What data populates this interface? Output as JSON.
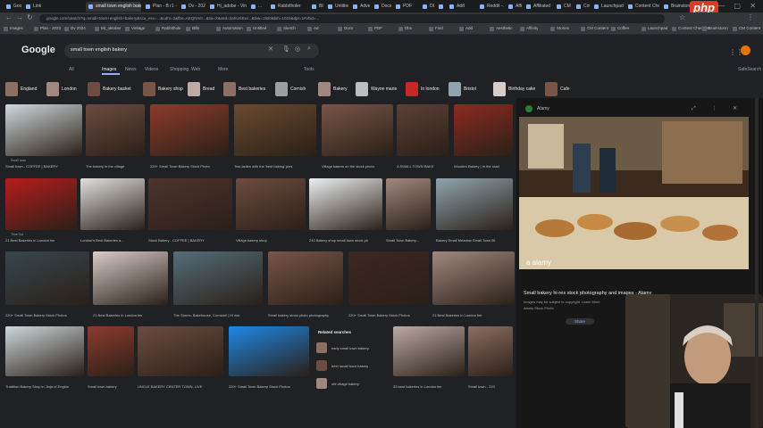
{
  "browser": {
    "tabs": [
      {
        "label": "Google"
      },
      {
        "label": "Link"
      },
      {
        "label": "small town english bakery"
      },
      {
        "label": "Plan - B r1 - 2023"
      },
      {
        "label": "Dv - 2024 - 2024"
      },
      {
        "label": "Hi_adobe - Vintage"
      },
      {
        "label": "..."
      },
      {
        "label": "Rabbitholer"
      },
      {
        "label": "Bills - Automation"
      },
      {
        "label": "Untitled - Sketch"
      },
      {
        "label": "Advertising"
      },
      {
        "label": "Docs"
      },
      {
        "label": "PDF"
      },
      {
        "label": "Dbx - ArI"
      },
      {
        "label": "Find"
      },
      {
        "label": "Add"
      },
      {
        "label": "Reddit - Aesthetic"
      },
      {
        "label": "Affinity"
      },
      {
        "label": "Affiliated - Stories"
      },
      {
        "label": "CM Content"
      },
      {
        "label": "Coffee"
      },
      {
        "label": "Launchpad"
      },
      {
        "label": "Content Checklist"
      },
      {
        "label": "Brainstorm"
      }
    ],
    "url": "google.com/search?q=small+town+english+bakery&sca_esv=...&udm=2&fbs=AEQNm0...&sa=X&ved=2ahUKEwi...&biw=1920&bih=1020&dpr=1#vhid=...",
    "watermark": "php",
    "bookmarks": [
      "Images",
      "Plan - 2023",
      "Dv 2024",
      "Mt_oktober",
      "Vintage",
      "Rabbithole",
      "Bills",
      "Automation",
      "Untitled",
      "Sketch",
      "Ad",
      "Docs",
      "PDF",
      "Dbx",
      "Find",
      "Add",
      "Aesthetic",
      "Affinity",
      "Stories",
      "CM Content",
      "Coffee",
      "Launchpad",
      "Content Checklist",
      "Brainstorm",
      "CM Content"
    ]
  },
  "google": {
    "logo": "Google",
    "query": "small town english bakery",
    "nav": [
      "All",
      "Images",
      "News",
      "Videos",
      "Shopping",
      "Web",
      "More"
    ],
    "tools": "Tools",
    "safesearch": "SafeSearch"
  },
  "chips": [
    {
      "label": "England",
      "color": "#8d6e63"
    },
    {
      "label": "London",
      "color": "#a1887f"
    },
    {
      "label": "Bakery basket",
      "color": "#6d4c41"
    },
    {
      "label": "Bakery shop",
      "color": "#795548"
    },
    {
      "label": "Bread",
      "color": "#bcaaa4"
    },
    {
      "label": "Best bakeries",
      "color": "#8d6e63"
    },
    {
      "label": "Cornish",
      "color": "#9e9e9e"
    },
    {
      "label": "Bakery",
      "color": "#a1887f"
    },
    {
      "label": "Wayne marie",
      "color": "#bdbdbd"
    },
    {
      "label": "In london",
      "color": "#c62828"
    },
    {
      "label": "Bristol",
      "color": "#90a4ae"
    },
    {
      "label": "Birthday cake",
      "color": "#d7ccc8"
    },
    {
      "label": "Cafe",
      "color": "#795548"
    }
  ],
  "results": [
    {
      "caption": "Small town - COFFEE | BAKERY",
      "source": "Small town",
      "color": "#cfd8dc"
    },
    {
      "caption": "The bakery in the village",
      "source": "",
      "color": "#6d4c41"
    },
    {
      "caption": "220+ Small Town Bakery Stock Photo",
      "source": "",
      "color": "#8d3b2b"
    },
    {
      "caption": "Two ladies with the 'best baking' pies",
      "source": "",
      "color": "#6b4a2f"
    },
    {
      "caption": "Village bakers on the stock photo",
      "source": "",
      "color": "#795548"
    },
    {
      "caption": "A SMALL TOWN BAKE",
      "source": "",
      "color": "#5d4037"
    },
    {
      "caption": "Wooden Bakery | In the road",
      "source": "",
      "color": "#8e2a20"
    },
    {
      "caption": "21 Best Bakeries in London tier",
      "source": "Time Out",
      "color": "#b71c1c"
    },
    {
      "caption": "London's Best Bakeries a...",
      "source": "",
      "color": "#e0e0e0"
    },
    {
      "caption": "Stock Bakery - COFFEE | BAKERY",
      "source": "",
      "color": "#4e342e"
    },
    {
      "caption": "Village bakery shop",
      "source": "",
      "color": "#6d4c41"
    },
    {
      "caption": "240 Bakery shop small town stock ph",
      "source": "",
      "color": "#eceff1"
    },
    {
      "caption": "Small Town Bakery...",
      "source": "",
      "color": "#a1887f"
    },
    {
      "caption": "Bakery Small Meadow Small Town Bt",
      "source": "",
      "color": "#90a4ae"
    },
    {
      "caption": "220+ Small Town Bakery Stock Photos",
      "source": "",
      "color": "#37474f"
    },
    {
      "caption": "21 Best Bakeries in London tier",
      "source": "",
      "color": "#d7ccc8"
    },
    {
      "caption": "The Stores, Bakehouse, Cornwall | HI rise",
      "source": "",
      "color": "#546e7a"
    },
    {
      "caption": "Small bakery stock photo photography",
      "source": "",
      "color": "#795548"
    },
    {
      "caption": "220+ Small Town Bakery Stock Photos",
      "source": "",
      "color": "#3e2723"
    },
    {
      "caption": "21 Best Bakeries in London tier",
      "source": "",
      "color": "#a1887f"
    },
    {
      "caption": "Tradition Bakery Shop in Jinja of Englan",
      "source": "",
      "color": "#cfd8dc"
    },
    {
      "caption": "Small town bakery",
      "source": "",
      "color": "#8e3b2e"
    },
    {
      "caption": "UNCLE BAKERY CENTER TOWN, LIVE",
      "source": "",
      "color": "#6d4c41"
    },
    {
      "caption": "220+ Small Town Bakery Stock Photos",
      "source": "",
      "color": "#1e88e5"
    },
    {
      "caption": "33 best bakeries in London tier",
      "source": "",
      "color": "#bcaaa4"
    },
    {
      "caption": "Small town - 220",
      "source": "",
      "color": "#8d6e63"
    }
  ],
  "related": {
    "title": "Related searches",
    "items": [
      {
        "label": "early small town bakery",
        "color": "#8d6e63"
      },
      {
        "label": "beer small town bakery",
        "color": "#6d4c41"
      },
      {
        "label": "old village bakery",
        "color": "#a1887f"
      }
    ]
  },
  "preview": {
    "site": "Alamy",
    "title": "Small bakery hi-res stock photography and images - Alamy",
    "meta": "Images may be subject to copyright. Learn More",
    "meta2": "Alamy Stock Photo",
    "share": "Share",
    "watermark": "a alamy"
  }
}
